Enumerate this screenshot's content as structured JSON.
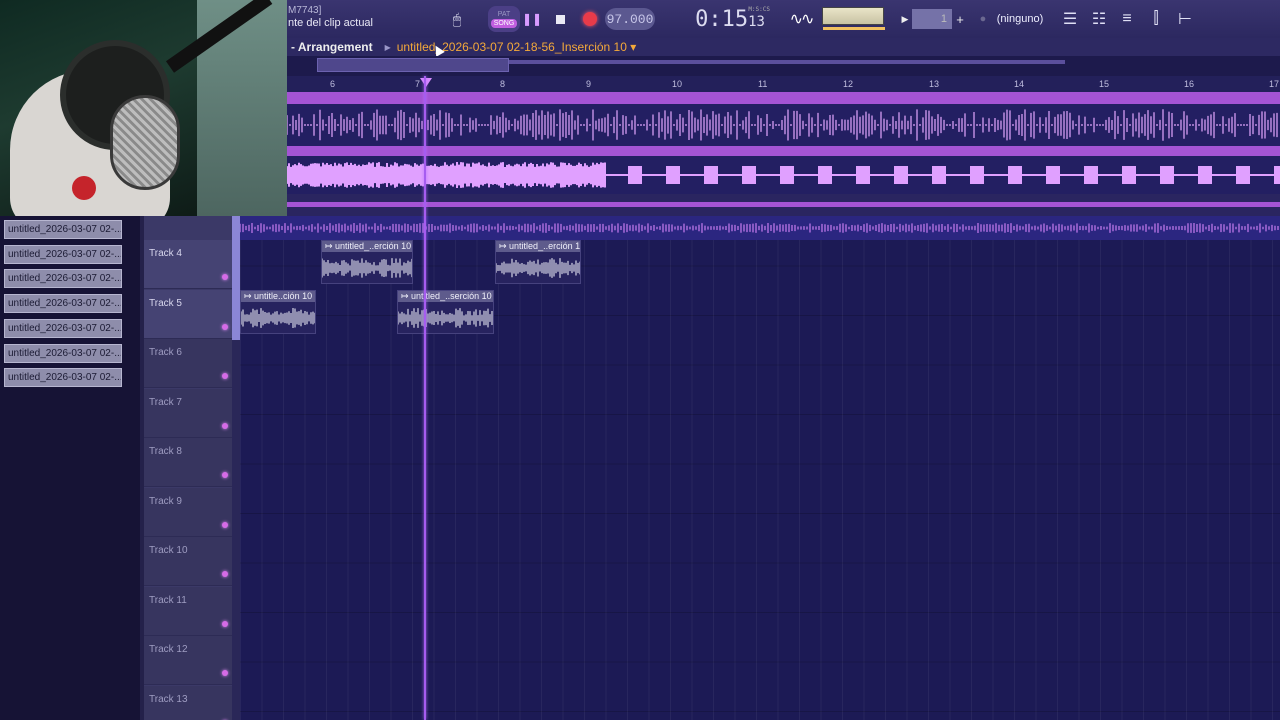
{
  "toolbar": {
    "hint_line1": "M7743]",
    "hint_line2": "nte del clip actual",
    "pat_label": "PAT",
    "song_label": "SONG",
    "tempo": "97.000",
    "time_main": "0:15",
    "time_sub": "13",
    "time_unit": "M:S:CS",
    "pattern_number": "1",
    "snap_label": "(ninguno)"
  },
  "breadcrumb": {
    "root": "Arrangement",
    "current": "untitled_2026-03-07 02-18-56_Inserción 10"
  },
  "ruler": {
    "ticks": [
      "6",
      "7",
      "8",
      "9",
      "10",
      "11",
      "12",
      "13",
      "14",
      "15",
      "16",
      "17"
    ]
  },
  "clip_list": [
    "untitled_2026-03-07 02-...",
    "untitled_2026-03-07 02-...",
    "untitled_2026-03-07 02-...",
    "untitled_2026-03-07 02-...",
    "untitled_2026-03-07 02-...",
    "untitled_2026-03-07 02-...",
    "untitled_2026-03-07 02-..."
  ],
  "tracks": [
    "Track 4",
    "Track 5",
    "Track 6",
    "Track 7",
    "Track 8",
    "Track 9",
    "Track 10",
    "Track 11",
    "Track 12",
    "Track 13"
  ],
  "clips": [
    {
      "label": "untitled_..erción 10",
      "track": "Track 4"
    },
    {
      "label": "untitled_..erción 10",
      "track": "Track 4"
    },
    {
      "label": "untitle..ción 10",
      "track": "Track 5"
    },
    {
      "label": "untitled_..serción 10",
      "track": "Track 5"
    }
  ],
  "colors": {
    "accent": "#b45fe0",
    "current_clip": "#f4a93a",
    "playhead": "#a65cf0",
    "grid_bg": "#1c1a55"
  },
  "icons": [
    "pause-icon",
    "stop-icon",
    "record-icon",
    "waveform-icon",
    "mixer-icon",
    "channel-rack-icon",
    "piano-roll-icon",
    "browser-icon",
    "plugin-icon"
  ]
}
